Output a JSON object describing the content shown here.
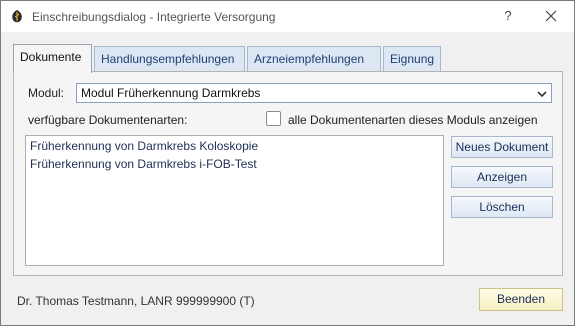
{
  "window": {
    "title": "Einschreibungsdialog - Integrierte Versorgung",
    "help_label": "?",
    "close_icon": "close-icon",
    "app_icon": "leaf-icon"
  },
  "tabs": [
    {
      "label": "Dokumente",
      "active": true
    },
    {
      "label": "Handlungsempfehlungen",
      "active": false
    },
    {
      "label": "Arzneiempfehlungen",
      "active": false
    },
    {
      "label": "Eignung",
      "active": false
    }
  ],
  "dokumente": {
    "modul_label": "Modul:",
    "modul_value": "Modul Früherkennung Darmkrebs",
    "available_label": "verfügbare Dokumentenarten:",
    "show_all_label": "alle Dokumentenarten dieses Moduls anzeigen",
    "show_all_checked": false,
    "items": [
      "Früherkennung von Darmkrebs Koloskopie",
      "Früherkennung von Darmkrebs i-FOB-Test"
    ],
    "buttons": {
      "new": "Neues Dokument",
      "show": "Anzeigen",
      "delete": "Löschen"
    }
  },
  "footer": {
    "user_text": "Dr. Thomas Testmann, LANR 999999900 (T)",
    "close_button": "Beenden"
  },
  "colors": {
    "tab_inactive_bg": "#dde7f4",
    "tab_text": "#1f3f73",
    "beenden_bg": "#f6f0c0"
  }
}
